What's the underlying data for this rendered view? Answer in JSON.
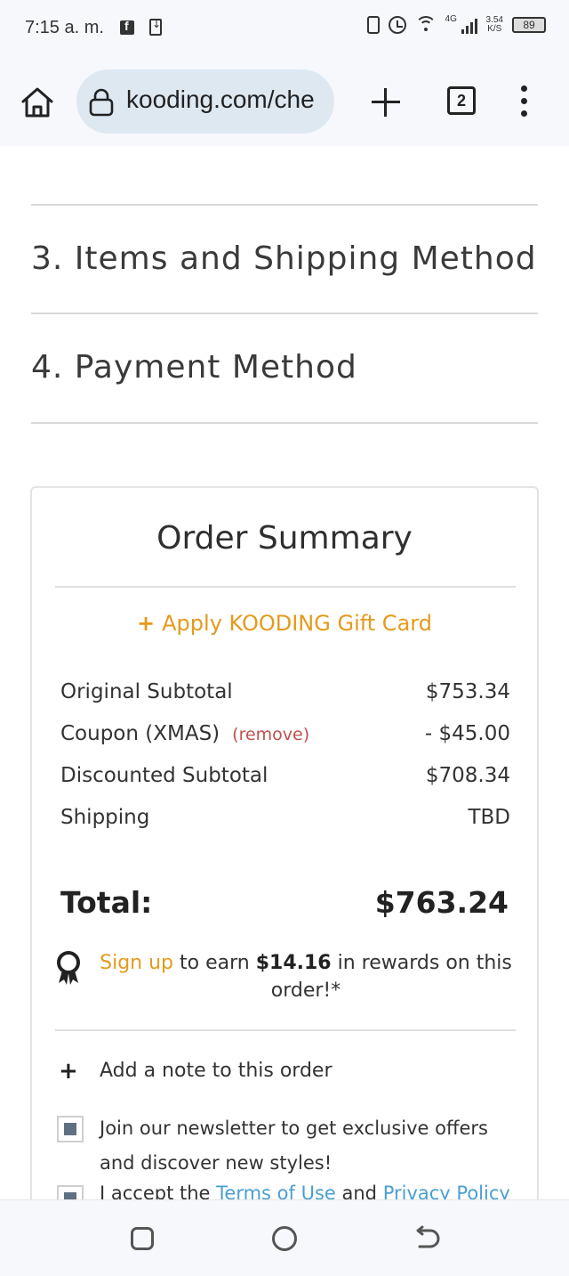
{
  "status_bar": {
    "time": "7:15 a. m.",
    "network": "4G",
    "speed_top": "3.54",
    "speed_bottom": "K/S",
    "battery": "89"
  },
  "browser": {
    "url": "kooding.com/che",
    "tab_count": "2",
    "icons": [
      "home-icon",
      "lock-icon",
      "new-tab-icon",
      "tabs-icon",
      "more-menu-icon"
    ]
  },
  "checkout": {
    "step3": "3. Items and Shipping Method",
    "step4": "4. Payment Method"
  },
  "summary": {
    "title": "Order Summary",
    "gift_card_plus": "+",
    "gift_card_label": "Apply KOODING Gift Card",
    "original_subtotal_label": "Original Subtotal",
    "original_subtotal_value": "$753.34",
    "coupon_label": "Coupon (XMAS)",
    "coupon_remove": "(remove)",
    "coupon_value": "- $45.00",
    "discounted_subtotal_label": "Discounted Subtotal",
    "discounted_subtotal_value": "$708.34",
    "shipping_label": "Shipping",
    "shipping_value": "TBD",
    "total_label": "Total:",
    "total_value": "$763.24",
    "rewards_signup": "Sign up",
    "rewards_pre": "to earn",
    "rewards_amount": "$14.16",
    "rewards_post": "in rewards on this order!*",
    "note_plus": "+",
    "note_label": "Add a note to this order",
    "newsletter_label": "Join our newsletter to get exclusive offers and discover new styles!",
    "terms_pre": "I accept the",
    "terms_link1": "Terms of Use",
    "terms_mid": "and",
    "terms_link2": "Privacy Policy"
  },
  "colors": {
    "accent_orange": "#e59a1c",
    "remove_red": "#c0504d",
    "link_blue": "#4a9fd1",
    "url_pill": "#dde8f1"
  }
}
